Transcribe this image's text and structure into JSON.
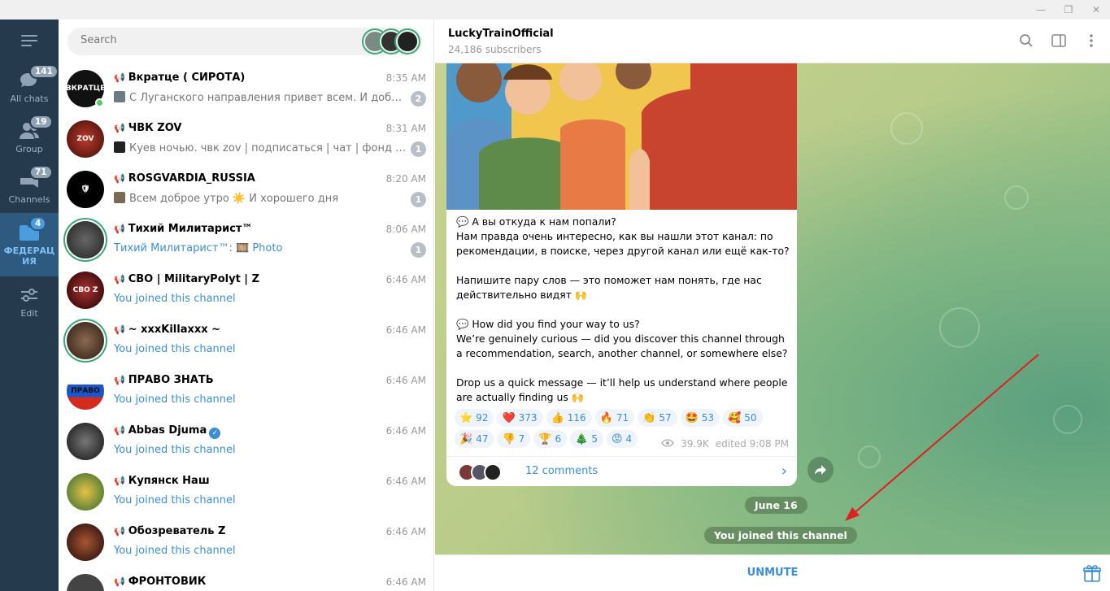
{
  "window": {
    "minimize": "—",
    "restore": "❐",
    "close": "✕"
  },
  "rail": {
    "items": [
      {
        "label": "All chats",
        "badge": "141",
        "icon": "chat-bubbles-icon"
      },
      {
        "label": "Group",
        "badge": "19",
        "icon": "group-icon"
      },
      {
        "label": "Channels",
        "badge": "71",
        "icon": "channels-icon"
      },
      {
        "label": "ФЕДЕРАЦИЯ",
        "badge": "4",
        "icon": "folder-icon",
        "active": true
      },
      {
        "label": "Edit",
        "badge": "",
        "icon": "edit-sliders-icon"
      }
    ]
  },
  "search": {
    "placeholder": "Search"
  },
  "chats": [
    {
      "name": "Вкратце ( СИРОТА)",
      "time": "8:35 AM",
      "preview": "С Луганского направления привет всем. И доброго у...",
      "badge": "2",
      "preview_style": "grey",
      "online": true
    },
    {
      "name": "ЧВК ZOV",
      "time": "8:31 AM",
      "preview": "Куев ночью.  чвк zov | подписаться | чат | фонд / от...",
      "badge": "1",
      "preview_style": "grey"
    },
    {
      "name": "ROSGVARDIA_RUSSIA",
      "time": "8:20 AM",
      "preview": "Всем доброе утро ☀️  И хорошего дня",
      "badge": "1",
      "preview_style": "grey"
    },
    {
      "name": "Тихий Милитарист™",
      "time": "8:06 AM",
      "preview_prefix": "Тихий Милитарист™: 🎞️ ",
      "preview": "Photo",
      "badge": "1",
      "preview_style": "blue"
    },
    {
      "name": "СВО | MilitaryPolyt | Z",
      "time": "6:46 AM",
      "preview": "You joined this channel",
      "badge": "",
      "preview_style": "blue"
    },
    {
      "name": "~ xxxKillaxxx ~",
      "time": "6:46 AM",
      "preview": "You joined this channel",
      "badge": "",
      "preview_style": "blue"
    },
    {
      "name": "ПРАВО ЗНАТЬ",
      "time": "6:46 AM",
      "preview": "You joined this channel",
      "badge": "",
      "preview_style": "blue"
    },
    {
      "name": "Abbas Djuma",
      "time": "6:46 AM",
      "preview": "You joined this channel",
      "badge": "",
      "preview_style": "blue",
      "verified": true
    },
    {
      "name": "Купянск Наш",
      "time": "6:46 AM",
      "preview": "You joined this channel",
      "badge": "",
      "preview_style": "blue"
    },
    {
      "name": "Обозреватель Z",
      "time": "6:46 AM",
      "preview": "You joined this channel",
      "badge": "",
      "preview_style": "blue"
    },
    {
      "name": "ФРОНТОВИК",
      "time": "6:46 AM",
      "preview": "",
      "badge": "",
      "preview_style": "blue"
    }
  ],
  "channel": {
    "title": "LuckyTrainOfficial",
    "subtitle": "24,186 subscribers"
  },
  "post": {
    "text": "💬 А вы откуда к нам попали?\nНам правда очень интересно, как вы нашли этот канал: по рекомендации, в поиске, через другой канал или ещё как-то?\n\nНапишите пару слов — это поможет нам понять, где нас действительно видят 🙌\n\n💬 How did you find your way to us?\nWe’re genuinely curious — did you discover this channel through a recommendation, search, another channel, or somewhere else?\n\nDrop us a quick message — it’ll help us understand where people are actually finding us 🙌",
    "reactions": [
      {
        "emoji": "⭐",
        "count": "92"
      },
      {
        "emoji": "❤️",
        "count": "373"
      },
      {
        "emoji": "👍",
        "count": "116"
      },
      {
        "emoji": "🔥",
        "count": "71"
      },
      {
        "emoji": "👏",
        "count": "57"
      },
      {
        "emoji": "🤩",
        "count": "53"
      },
      {
        "emoji": "🥰",
        "count": "50"
      },
      {
        "emoji": "🎉",
        "count": "47"
      },
      {
        "emoji": "👎",
        "count": "7"
      },
      {
        "emoji": "🏆",
        "count": "6"
      },
      {
        "emoji": "🎄",
        "count": "5"
      },
      {
        "emoji": "😡",
        "count": "4"
      }
    ],
    "views": "39.9K",
    "edited": "edited 9:08 PM",
    "comments": "12 comments"
  },
  "date_pill": "June 16",
  "service_message": "You joined this channel",
  "footer": {
    "unmute": "UNMUTE"
  }
}
